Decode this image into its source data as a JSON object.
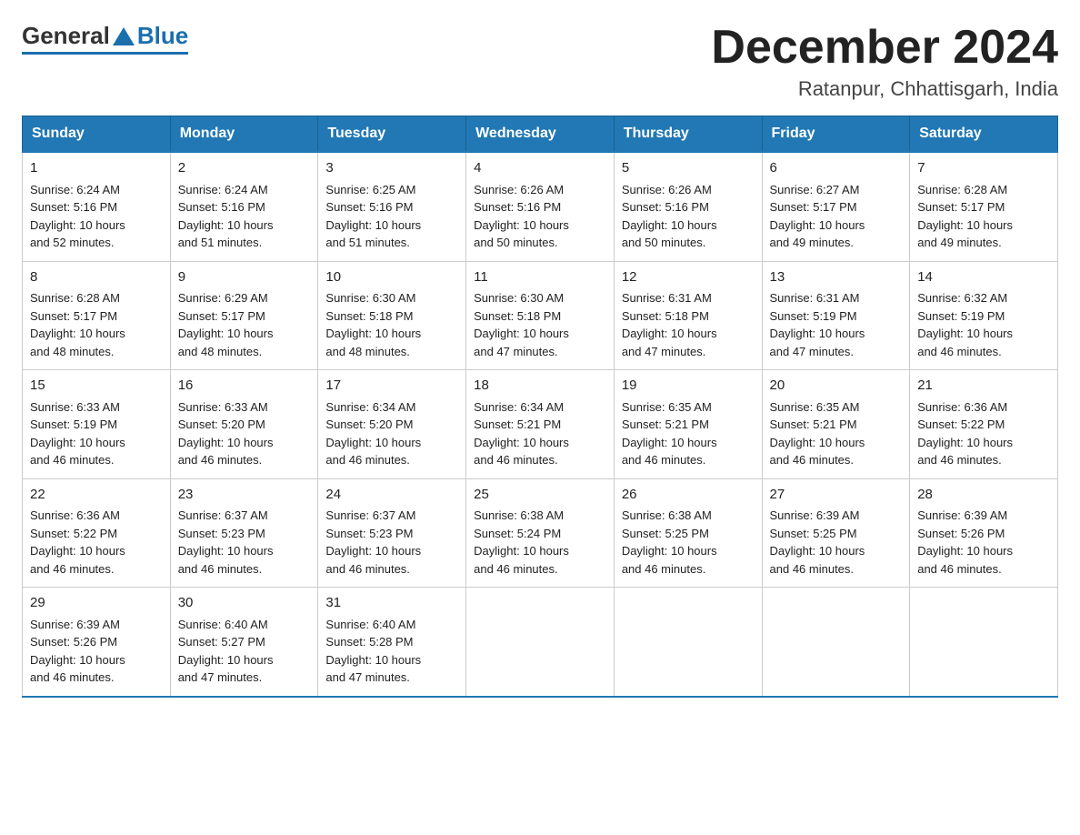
{
  "logo": {
    "general": "General",
    "blue": "Blue"
  },
  "title": "December 2024",
  "subtitle": "Ratanpur, Chhattisgarh, India",
  "days_of_week": [
    "Sunday",
    "Monday",
    "Tuesday",
    "Wednesday",
    "Thursday",
    "Friday",
    "Saturday"
  ],
  "weeks": [
    [
      {
        "day": "1",
        "sunrise": "6:24 AM",
        "sunset": "5:16 PM",
        "daylight": "10 hours and 52 minutes."
      },
      {
        "day": "2",
        "sunrise": "6:24 AM",
        "sunset": "5:16 PM",
        "daylight": "10 hours and 51 minutes."
      },
      {
        "day": "3",
        "sunrise": "6:25 AM",
        "sunset": "5:16 PM",
        "daylight": "10 hours and 51 minutes."
      },
      {
        "day": "4",
        "sunrise": "6:26 AM",
        "sunset": "5:16 PM",
        "daylight": "10 hours and 50 minutes."
      },
      {
        "day": "5",
        "sunrise": "6:26 AM",
        "sunset": "5:16 PM",
        "daylight": "10 hours and 50 minutes."
      },
      {
        "day": "6",
        "sunrise": "6:27 AM",
        "sunset": "5:17 PM",
        "daylight": "10 hours and 49 minutes."
      },
      {
        "day": "7",
        "sunrise": "6:28 AM",
        "sunset": "5:17 PM",
        "daylight": "10 hours and 49 minutes."
      }
    ],
    [
      {
        "day": "8",
        "sunrise": "6:28 AM",
        "sunset": "5:17 PM",
        "daylight": "10 hours and 48 minutes."
      },
      {
        "day": "9",
        "sunrise": "6:29 AM",
        "sunset": "5:17 PM",
        "daylight": "10 hours and 48 minutes."
      },
      {
        "day": "10",
        "sunrise": "6:30 AM",
        "sunset": "5:18 PM",
        "daylight": "10 hours and 48 minutes."
      },
      {
        "day": "11",
        "sunrise": "6:30 AM",
        "sunset": "5:18 PM",
        "daylight": "10 hours and 47 minutes."
      },
      {
        "day": "12",
        "sunrise": "6:31 AM",
        "sunset": "5:18 PM",
        "daylight": "10 hours and 47 minutes."
      },
      {
        "day": "13",
        "sunrise": "6:31 AM",
        "sunset": "5:19 PM",
        "daylight": "10 hours and 47 minutes."
      },
      {
        "day": "14",
        "sunrise": "6:32 AM",
        "sunset": "5:19 PM",
        "daylight": "10 hours and 46 minutes."
      }
    ],
    [
      {
        "day": "15",
        "sunrise": "6:33 AM",
        "sunset": "5:19 PM",
        "daylight": "10 hours and 46 minutes."
      },
      {
        "day": "16",
        "sunrise": "6:33 AM",
        "sunset": "5:20 PM",
        "daylight": "10 hours and 46 minutes."
      },
      {
        "day": "17",
        "sunrise": "6:34 AM",
        "sunset": "5:20 PM",
        "daylight": "10 hours and 46 minutes."
      },
      {
        "day": "18",
        "sunrise": "6:34 AM",
        "sunset": "5:21 PM",
        "daylight": "10 hours and 46 minutes."
      },
      {
        "day": "19",
        "sunrise": "6:35 AM",
        "sunset": "5:21 PM",
        "daylight": "10 hours and 46 minutes."
      },
      {
        "day": "20",
        "sunrise": "6:35 AM",
        "sunset": "5:21 PM",
        "daylight": "10 hours and 46 minutes."
      },
      {
        "day": "21",
        "sunrise": "6:36 AM",
        "sunset": "5:22 PM",
        "daylight": "10 hours and 46 minutes."
      }
    ],
    [
      {
        "day": "22",
        "sunrise": "6:36 AM",
        "sunset": "5:22 PM",
        "daylight": "10 hours and 46 minutes."
      },
      {
        "day": "23",
        "sunrise": "6:37 AM",
        "sunset": "5:23 PM",
        "daylight": "10 hours and 46 minutes."
      },
      {
        "day": "24",
        "sunrise": "6:37 AM",
        "sunset": "5:23 PM",
        "daylight": "10 hours and 46 minutes."
      },
      {
        "day": "25",
        "sunrise": "6:38 AM",
        "sunset": "5:24 PM",
        "daylight": "10 hours and 46 minutes."
      },
      {
        "day": "26",
        "sunrise": "6:38 AM",
        "sunset": "5:25 PM",
        "daylight": "10 hours and 46 minutes."
      },
      {
        "day": "27",
        "sunrise": "6:39 AM",
        "sunset": "5:25 PM",
        "daylight": "10 hours and 46 minutes."
      },
      {
        "day": "28",
        "sunrise": "6:39 AM",
        "sunset": "5:26 PM",
        "daylight": "10 hours and 46 minutes."
      }
    ],
    [
      {
        "day": "29",
        "sunrise": "6:39 AM",
        "sunset": "5:26 PM",
        "daylight": "10 hours and 46 minutes."
      },
      {
        "day": "30",
        "sunrise": "6:40 AM",
        "sunset": "5:27 PM",
        "daylight": "10 hours and 47 minutes."
      },
      {
        "day": "31",
        "sunrise": "6:40 AM",
        "sunset": "5:28 PM",
        "daylight": "10 hours and 47 minutes."
      },
      null,
      null,
      null,
      null
    ]
  ],
  "labels": {
    "sunrise": "Sunrise:",
    "sunset": "Sunset:",
    "daylight": "Daylight:"
  }
}
